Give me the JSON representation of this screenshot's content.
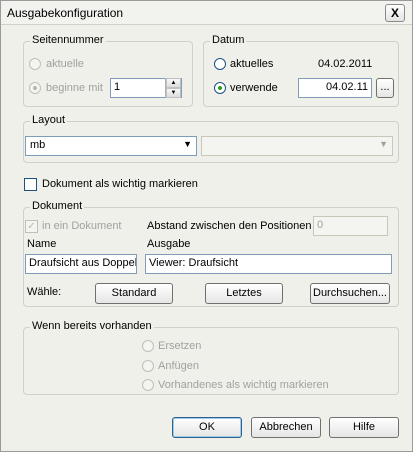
{
  "window": {
    "title": "Ausgabekonfiguration",
    "close": "X"
  },
  "seitennummer": {
    "title": "Seitennummer",
    "aktuelle": "aktuelle",
    "beginne_mit": "beginne mit",
    "start_value": "1"
  },
  "datum": {
    "title": "Datum",
    "aktuelles": "aktuelles",
    "aktuelles_value": "04.02.2011",
    "verwende": "verwende",
    "verwende_value": "04.02.11",
    "picker": "..."
  },
  "layout": {
    "title": "Layout",
    "selected": "mb",
    "second_selected": ""
  },
  "wichtig_checkbox": {
    "label": "Dokument als wichtig markieren"
  },
  "dokument": {
    "title": "Dokument",
    "in_ein_dokument": "in ein Dokument",
    "abstand_label": "Abstand zwischen den Positionen",
    "abstand_value": "0",
    "name_header": "Name",
    "ausgabe_header": "Ausgabe",
    "name_value": "Draufsicht aus Doppelb",
    "ausgabe_value": "Viewer: Draufsicht",
    "waehle": "Wähle:",
    "standard": "Standard",
    "letztes": "Letztes",
    "durchsuchen": "Durchsuchen..."
  },
  "vorhanden": {
    "title": "Wenn bereits vorhanden",
    "ersetzen": "Ersetzen",
    "anfuegen": "Anfügen",
    "vorhandenes": "Vorhandenes als wichtig markieren"
  },
  "buttons": {
    "ok": "OK",
    "abbrechen": "Abbrechen",
    "hilfe": "Hilfe"
  }
}
